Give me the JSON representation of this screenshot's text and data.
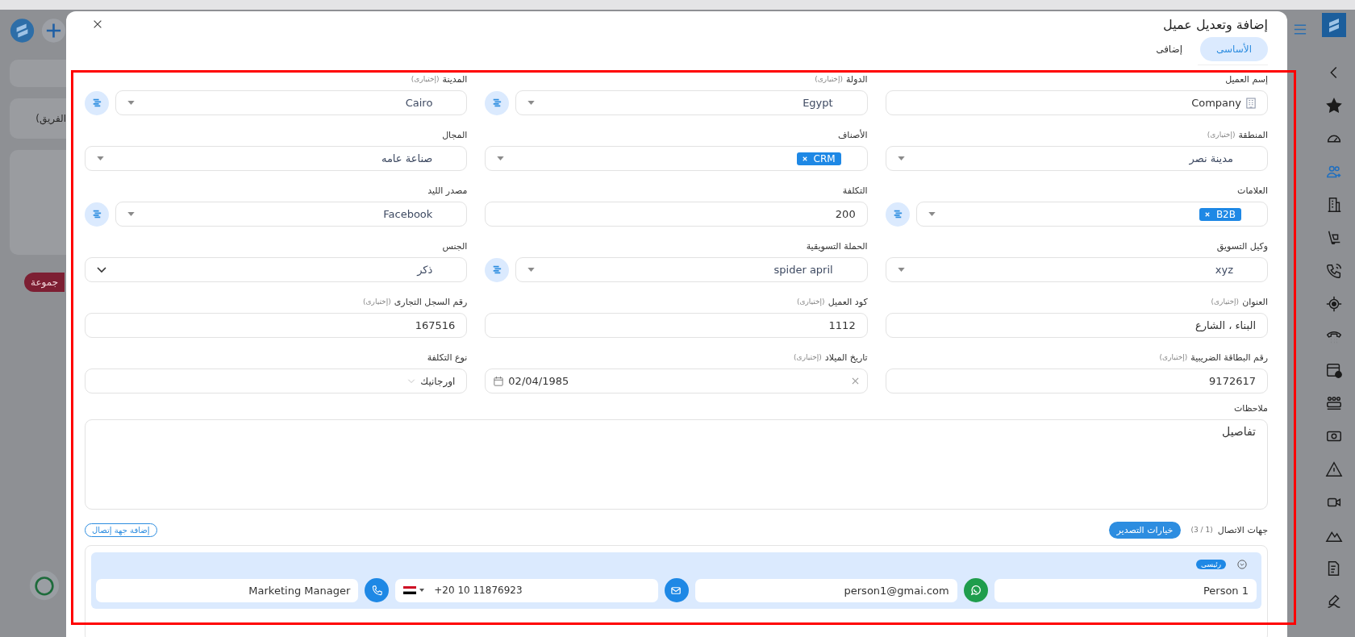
{
  "background": {
    "team_label": "(الفريق",
    "group_pill": "جموعة"
  },
  "dialog": {
    "title": "إضافة وتعديل عميل"
  },
  "tabs": [
    {
      "label": "الأساسى",
      "selected": true
    },
    {
      "label": "إضافى",
      "selected": false
    }
  ],
  "form_rows": [
    [
      {
        "label": "إسم العميل",
        "kind": "company-input",
        "value": "Company",
        "add_button": false
      },
      {
        "label": "الدولة",
        "hint": "(إختيارى)",
        "kind": "select",
        "value": "Egypt",
        "add_button": true
      },
      {
        "label": "المدينة",
        "hint": "(إختيارى)",
        "kind": "select",
        "value": "Cairo",
        "add_button": true
      }
    ],
    [
      {
        "label": "المنطقة",
        "hint": "(إختيارى)",
        "kind": "select",
        "value": "مدينة نصر",
        "add_button": false
      },
      {
        "label": "الأصناف",
        "kind": "tags",
        "tags": [
          "CRM"
        ],
        "add_button": false
      },
      {
        "label": "المجال",
        "kind": "select",
        "value": "صناعة عامه",
        "add_button": false
      }
    ],
    [
      {
        "label": "العلامات",
        "kind": "tags",
        "tags": [
          "B2B"
        ],
        "add_button": true
      },
      {
        "label": "التكلفة",
        "kind": "input",
        "value": "200",
        "add_button": false
      },
      {
        "label": "مصدر الليد",
        "kind": "select",
        "value": "Facebook",
        "add_button": true
      }
    ],
    [
      {
        "label": "وكيل التسويق",
        "kind": "select",
        "value": "xyz",
        "add_button": false
      },
      {
        "label": "الحملة التسويقية",
        "kind": "select",
        "value": "spider april",
        "add_button": true
      },
      {
        "label": "الجنس",
        "kind": "chevron-select",
        "value": "ذكر",
        "add_button": false
      }
    ],
    [
      {
        "label": "العنوان",
        "hint": "(إختيارى)",
        "kind": "input",
        "value": "البناء ، الشارع",
        "add_button": false
      },
      {
        "label": "كود العميل",
        "hint": "(إختيارى)",
        "kind": "input",
        "value": "1112",
        "add_button": false
      },
      {
        "label": "رقم السجل التجارى",
        "hint": "(إختيارى)",
        "kind": "input",
        "value": "167516",
        "add_button": false
      }
    ],
    [
      {
        "label": "رقم البطاقة الضريبية",
        "hint": "(إختيارى)",
        "kind": "input",
        "value": "9172617",
        "add_button": false
      },
      {
        "label": "تاريخ الميلاد",
        "hint": "(إختيارى)",
        "kind": "date",
        "value": "02/04/1985",
        "add_button": false
      },
      {
        "label": "نوع التكلفة",
        "kind": "plain-select",
        "value": "اورجانيك",
        "add_button": false
      }
    ]
  ],
  "notes": {
    "label": "ملاحظات",
    "value": "تفاصيل"
  },
  "contacts": {
    "label": "جهات الاتصال",
    "count": "(1 / 3)",
    "export_button": "خيارات التصدير",
    "add_button": "إضافة جهة إتصال",
    "items": [
      {
        "badge": "رئيسى",
        "name": "Person 1",
        "email": "person1@gmai.com",
        "phone": "+20 10 11876923",
        "job_title": "Marketing Manager"
      }
    ]
  },
  "sidebar": {
    "items": [
      {
        "selected": false
      },
      {
        "selected": false
      },
      {
        "selected": false
      },
      {
        "selected": true
      },
      {
        "selected": false
      },
      {
        "selected": false
      },
      {
        "selected": false
      },
      {
        "selected": false
      },
      {
        "selected": false
      },
      {
        "selected": false
      },
      {
        "selected": false
      },
      {
        "selected": false
      },
      {
        "selected": false
      },
      {
        "selected": false
      },
      {
        "selected": false
      },
      {
        "selected": false
      },
      {
        "selected": false
      }
    ]
  }
}
